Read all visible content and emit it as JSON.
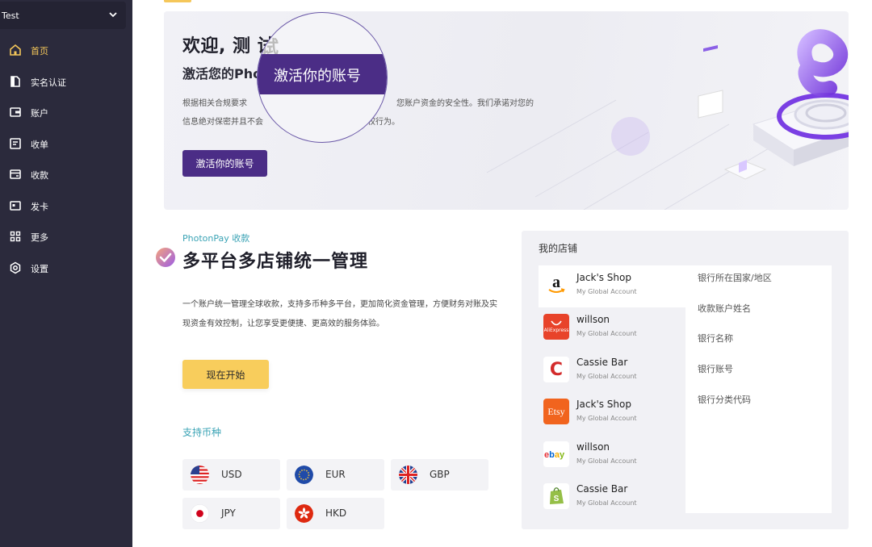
{
  "sidebar": {
    "workspace": "Test",
    "items": [
      {
        "label": "首页",
        "icon": "home-icon",
        "active": true
      },
      {
        "label": "实名认证",
        "icon": "id-card-icon"
      },
      {
        "label": "账户",
        "icon": "wallet-icon"
      },
      {
        "label": "收单",
        "icon": "receipt-icon"
      },
      {
        "label": "收款",
        "icon": "collection-icon"
      },
      {
        "label": "发卡",
        "icon": "card-icon"
      },
      {
        "label": "更多",
        "icon": "grid-icon"
      },
      {
        "label": "设置",
        "icon": "gear-icon"
      }
    ],
    "accent": "#f5c75a",
    "background": "#2b2a3c"
  },
  "hero": {
    "title": "欢迎, 测 试",
    "subtitle": "激活您的Pho",
    "desc_line1": "根据相关合规要求",
    "desc_line1_end": "您账户资金的安全性。我们承诺对您的",
    "desc_line2": "信息绝对保密并且不会",
    "desc_line2_end": "权行为。",
    "button": "激活你的账号",
    "magnifier_text": "激活你的账号",
    "button_color": "#4b2d86"
  },
  "section": {
    "tagline": "PhotonPay 收款",
    "title": "多平台多店铺统一管理",
    "desc": "一个账户统一管理全球收款，支持多币种多平台，更加简化资金管理，方便财务对账及实现资金有效控制，让您享受更便捷、更高效的服务体验。",
    "start_button": "现在开始",
    "currency_title": "支持币种",
    "currencies": [
      {
        "code": "USD",
        "icon": "us-flag-icon"
      },
      {
        "code": "EUR",
        "icon": "eu-flag-icon"
      },
      {
        "code": "GBP",
        "icon": "uk-flag-icon"
      },
      {
        "code": "JPY",
        "icon": "japan-flag-icon"
      },
      {
        "code": "HKD",
        "icon": "hongkong-flag-icon"
      }
    ]
  },
  "stores": {
    "title": "我的店铺",
    "items": [
      {
        "name": "Jack's Shop",
        "sub": "My Global Account",
        "platform": "amazon-logo-icon",
        "selected": true
      },
      {
        "name": "willson",
        "sub": "My Global Account",
        "platform": "aliexpress-logo-icon",
        "logo_text": "AliExpress"
      },
      {
        "name": "Cassie Bar",
        "sub": "My Global Account",
        "platform": "c-logo-icon",
        "logo_text": "C"
      },
      {
        "name": "Jack's Shop",
        "sub": "My Global Account",
        "platform": "etsy-logo-icon",
        "logo_text": "Etsy"
      },
      {
        "name": "willson",
        "sub": "My Global Account",
        "platform": "ebay-logo-icon",
        "logo_text": "ebay"
      },
      {
        "name": "Cassie Bar",
        "sub": "My Global Account",
        "platform": "shopify-logo-icon"
      }
    ],
    "bank_fields": [
      "银行所在国家/地区",
      "收款账户姓名",
      "银行名称",
      "银行账号",
      "银行分类代码"
    ]
  }
}
